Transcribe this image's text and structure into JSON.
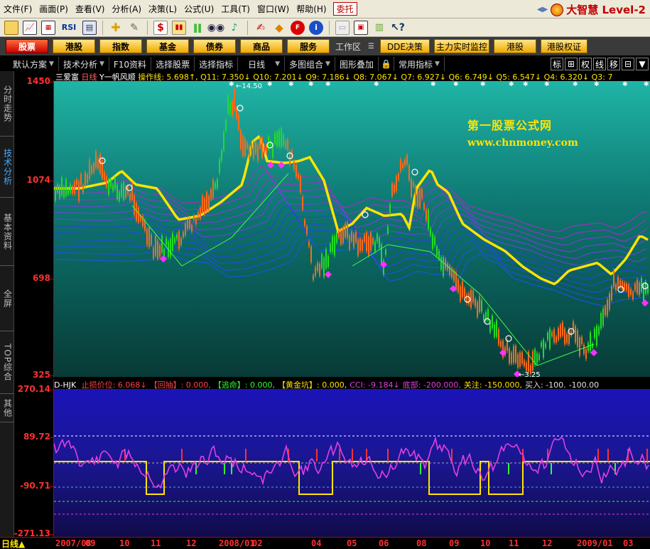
{
  "menu": [
    "文件(F)",
    "画面(P)",
    "查看(V)",
    "分析(A)",
    "决策(L)",
    "公式(U)",
    "工具(T)",
    "窗口(W)",
    "帮助(H)"
  ],
  "menu_special": "委托",
  "brand": {
    "name": "大智慧 Level-2"
  },
  "toolbar_icons": [
    "open-icon",
    "chart-icon",
    "indicator-icon",
    "rsi-icon",
    "grid-icon",
    "crosshair-icon",
    "ruler-icon",
    "dollar-icon",
    "kline-icon",
    "bars-icon",
    "binocular-icon",
    "bell-icon",
    "note-icon",
    "diamond-icon",
    "f10-icon",
    "info-icon",
    "blank-page-icon",
    "window-icon",
    "books-icon",
    "help-icon"
  ],
  "toolbar_rsi": "RSI",
  "categories": [
    "股票",
    "港股",
    "指数",
    "基金",
    "债券",
    "商品",
    "服务"
  ],
  "workspace": {
    "label": "工作区",
    "items": [
      "DDE决策",
      "主力实时监控",
      "港股",
      "港股权证"
    ]
  },
  "funcbar": {
    "items": [
      "默认方案",
      "技术分析",
      "F10资料",
      "选择股票",
      "选择指标",
      "日线",
      "多图组合",
      "图形叠加",
      "常用指标"
    ],
    "right": [
      "标",
      "⊞",
      "权",
      "线",
      "移",
      "⊟",
      "▼"
    ]
  },
  "left_tabs": [
    "分时走势",
    "技术分析",
    "基本资料",
    "全屏",
    "TOP综合",
    "其他"
  ],
  "main": {
    "title_prefix": "三爱富",
    "title_period": "日线",
    "title_indicator": "Y一帆风顺",
    "title_values": "操作线: 5.698↑, Q11: 7.350↓ Q10: 7.201↓ Q9: 7.186↓ Q8: 7.067↓ Q7: 6.927↓ Q6: 6.749↓ Q5: 6.547↓ Q4: 6.320↓ Q3: 7",
    "y_labels": [
      "1450",
      "1074",
      "698",
      "325"
    ],
    "annot_high": "14.50",
    "annot_low": "3.25"
  },
  "watermark": {
    "line1": "第一股票公式网",
    "line2": "www.chnmoney.com"
  },
  "indicator": {
    "title": "D-HJK",
    "items": [
      {
        "label": "止损价位:",
        "value": "6.068↓",
        "color": "#ff4040"
      },
      {
        "label": "【回抽】:",
        "value": "0.000,",
        "color": "#ff4040"
      },
      {
        "label": "【逃命】:",
        "value": "0.000,",
        "color": "#30ff30"
      },
      {
        "label": "【黄金坑】:",
        "value": "0.000,",
        "color": "#ffe400"
      },
      {
        "label": "CCI:",
        "value": "-9.184↓",
        "color": "#e040e0"
      },
      {
        "label": "底部:",
        "value": "-200.000,",
        "color": "#e040e0"
      },
      {
        "label": "关注:",
        "value": "-150.000,",
        "color": "#ffe400"
      },
      {
        "label": "买入:",
        "value": "-100.",
        "color": "#e0e0e0"
      },
      {
        "label": "",
        "value": "-100.00",
        "color": "#e0e0e0"
      }
    ],
    "y_labels": [
      "270.14",
      "89.72",
      "-90.71",
      "-271.13"
    ]
  },
  "date_axis": {
    "period": "日线",
    "labels": [
      "2007/08",
      "09",
      "10",
      "11",
      "12",
      "2008/01",
      "02",
      "04",
      "05",
      "06",
      "08",
      "09",
      "10",
      "11",
      "12",
      "2009/01",
      "03"
    ]
  },
  "colors": {
    "up": "#ff6a1a",
    "down": "#22dd22",
    "ma_yellow": "#ffe400",
    "cci": "#e040e0",
    "axis": "#ff3030"
  }
}
